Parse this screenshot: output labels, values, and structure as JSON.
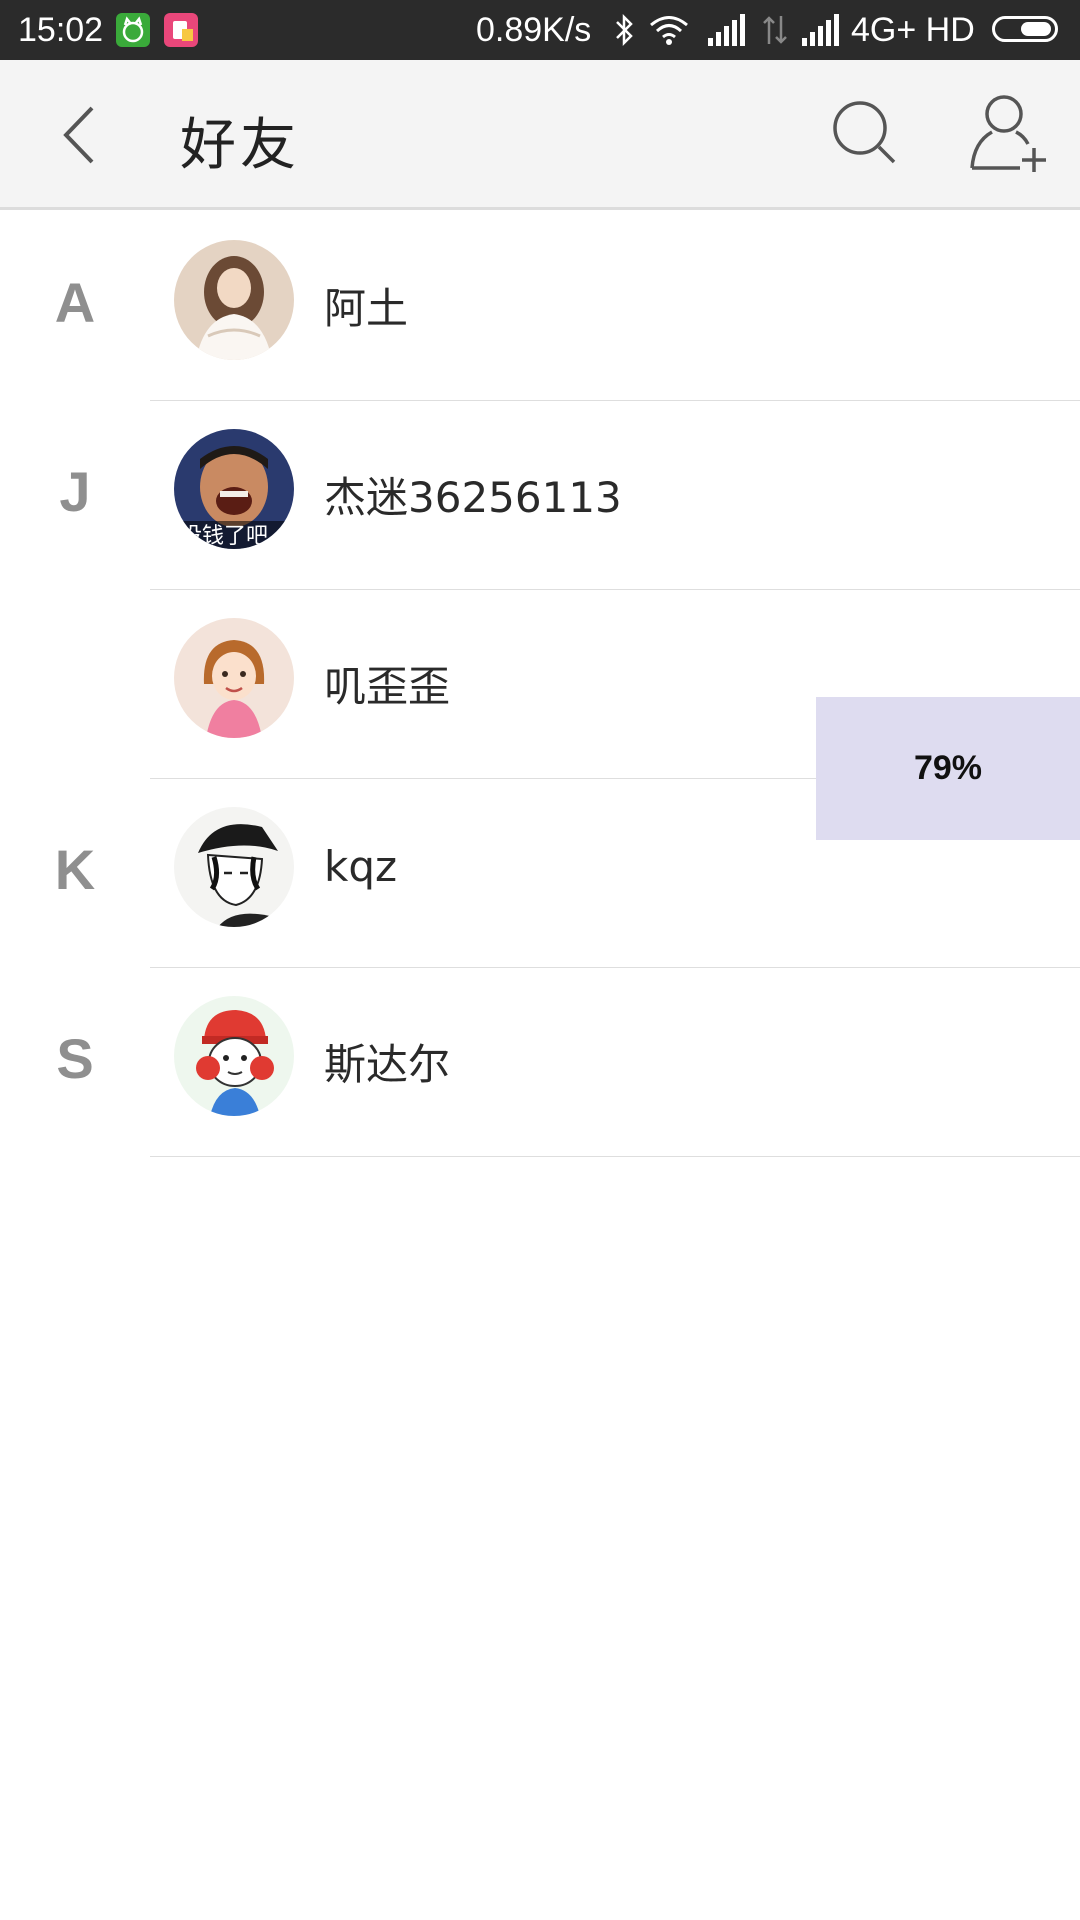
{
  "status_bar": {
    "time": "15:02",
    "net_speed": "0.89K/s",
    "network": "4G+ HD",
    "icons": [
      "cat-app-icon",
      "shopping-app-icon",
      "bluetooth-icon",
      "wifi-icon",
      "signal-icon",
      "data-transfer-icon",
      "signal-icon",
      "battery-icon"
    ]
  },
  "header": {
    "title": "好友",
    "icons": [
      "back-arrow-icon",
      "search-icon",
      "add-friend-icon"
    ]
  },
  "friends": [
    {
      "index": "A",
      "name": "阿土",
      "avatar": "girl-photo-avatar"
    },
    {
      "index": "J",
      "name": "杰迷36256113",
      "avatar": "laughing-man-avatar",
      "avatar_caption": "没钱了吧"
    },
    {
      "index": "",
      "name": "叽歪歪",
      "avatar": "cartoon-girl-avatar"
    },
    {
      "index": "K",
      "name": "kqz",
      "avatar": "sketch-boy-avatar"
    },
    {
      "index": "S",
      "name": "斯达尔",
      "avatar": "cartoon-boy-red-cap-avatar"
    }
  ],
  "progress_overlay": {
    "label": "79%",
    "value": 0.79
  },
  "colors": {
    "status_bar_bg": "#2b2b2b",
    "header_bg": "#f4f4f4",
    "index_letter": "#8f8f8f",
    "overlay_bg": "#dedcf0"
  }
}
